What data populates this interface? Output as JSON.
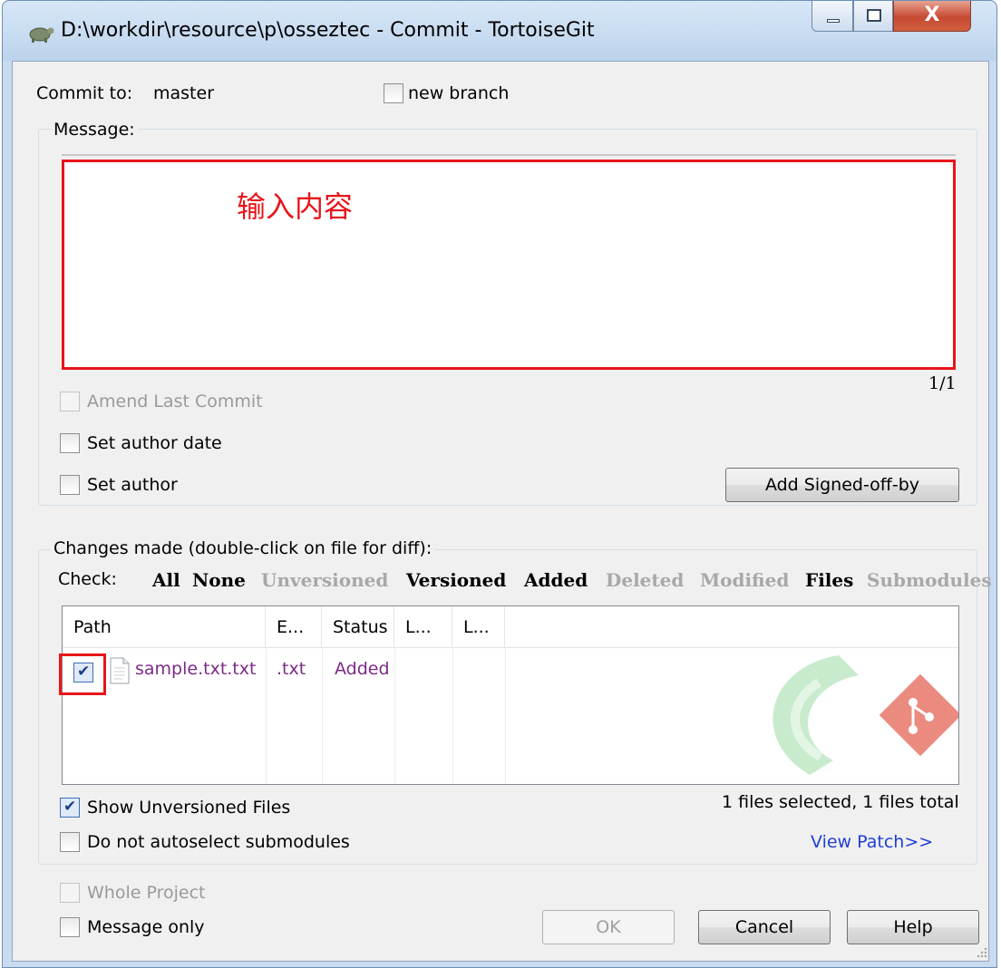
{
  "window": {
    "title": "D:\\workdir\\resource\\p\\osseztec - Commit - TortoiseGit",
    "close_glyph": "X"
  },
  "commit": {
    "to_label": "Commit to:",
    "branch": "master",
    "new_branch_label": "new branch",
    "new_branch_checked": false
  },
  "message": {
    "group_label": "Message:",
    "overlay_text": "输入内容",
    "counter": "1/1",
    "highlight_color": "#e8141a"
  },
  "options": {
    "amend_label": "Amend Last Commit",
    "author_date_label": "Set author date",
    "set_author_label": "Set author",
    "signed_off_button": "Add Signed-off-by"
  },
  "changes": {
    "group_label": "Changes made (double-click on file for diff):",
    "check_label": "Check:",
    "filters": [
      {
        "label": "All",
        "enabled": true
      },
      {
        "label": "None",
        "enabled": true
      },
      {
        "label": "Unversioned",
        "enabled": false
      },
      {
        "label": "Versioned",
        "enabled": true
      },
      {
        "label": "Added",
        "enabled": true
      },
      {
        "label": "Deleted",
        "enabled": false
      },
      {
        "label": "Modified",
        "enabled": false
      },
      {
        "label": "Files",
        "enabled": true
      },
      {
        "label": "Submodules",
        "enabled": false
      }
    ],
    "columns": [
      "Path",
      "E...",
      "Status",
      "L...",
      "L..."
    ],
    "rows": [
      {
        "path": "sample.txt.txt",
        "ext": ".txt",
        "status": "Added",
        "checked": true
      }
    ],
    "show_unversioned_label": "Show Unversioned Files",
    "show_unversioned_checked": true,
    "no_autoselect_label": "Do not autoselect submodules",
    "summary": "1 files selected, 1 files total",
    "view_patch": "View Patch>>"
  },
  "footer": {
    "whole_project_label": "Whole Project",
    "message_only_label": "Message only",
    "ok": "OK",
    "cancel": "Cancel",
    "help": "Help"
  }
}
